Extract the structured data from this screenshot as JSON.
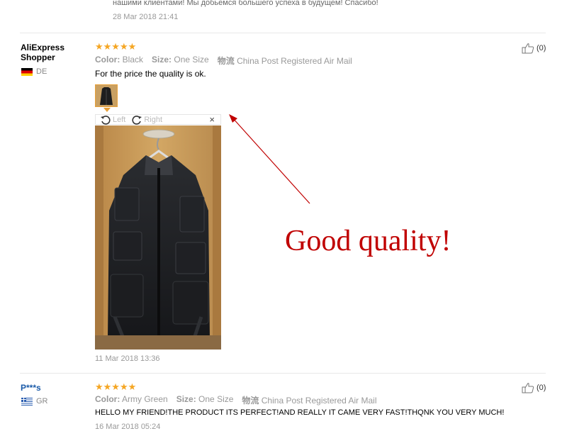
{
  "previous_review": {
    "text_tail": "нашими клиентами! Мы добьемся большего успеха в будущем! Спасибо!",
    "date": "28 Mar 2018 21:41"
  },
  "reviews": [
    {
      "user": "AliExpress Shopper",
      "user_line1": "AliExpress",
      "user_line2": "Shopper",
      "country": "DE",
      "stars": "★★★★★",
      "rating": 5,
      "color_label": "Color:",
      "color": "Black",
      "size_label": "Size:",
      "size": "One Size",
      "shipping_label": "物流",
      "shipping": "China Post Registered Air Mail",
      "text": "For the price the quality is ok.",
      "viewer": {
        "left_label": "Left",
        "right_label": "Right",
        "close": "×"
      },
      "date": "11 Mar 2018 13:36",
      "helpful_count": "(0)"
    },
    {
      "user": "P***s",
      "country": "GR",
      "stars": "★★★★★",
      "rating": 5,
      "color_label": "Color:",
      "color": "Army Green",
      "size_label": "Size:",
      "size": "One Size",
      "shipping_label": "物流",
      "shipping": "China Post Registered Air Mail",
      "text": "HELLO MY FRIEND!THE PRODUCT ITS PERFECT!AND REALLY IT CAME VERY FAST!THQNK YOU VERY MUCH!",
      "date": "16 Mar 2018 05:24",
      "helpful_count": "(0)"
    }
  ],
  "annotation": {
    "text": "Good quality!",
    "color": "#c00000"
  },
  "colors": {
    "star": "#f5a623",
    "accent_border": "#e8a13a",
    "masked_user": "#1a5aa8"
  }
}
